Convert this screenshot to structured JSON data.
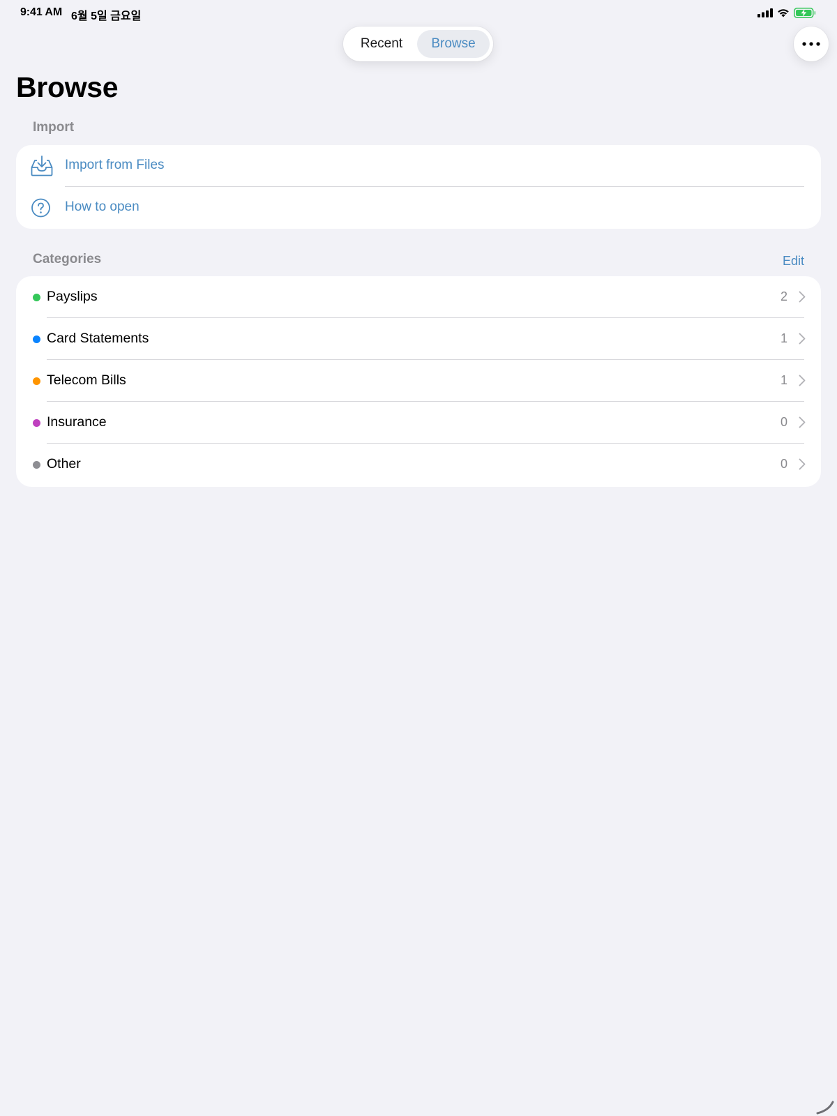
{
  "status_bar": {
    "time": "9:41 AM",
    "date": "6월 5일 금요일",
    "battery_color": "#34c759"
  },
  "segmented_control": {
    "options": [
      "Recent",
      "Browse"
    ],
    "selected": "Browse"
  },
  "more_button": {
    "icon": "ellipsis-icon"
  },
  "page": {
    "title": "Browse"
  },
  "import_section": {
    "header": "Import",
    "items": [
      {
        "label": "Import from Files",
        "icon": "tray-download-icon"
      },
      {
        "label": "How to open",
        "icon": "question-circle-icon"
      }
    ]
  },
  "categories_section": {
    "header": "Categories",
    "edit_label": "Edit",
    "items": [
      {
        "label": "Payslips",
        "count": "2",
        "color": "#34c759"
      },
      {
        "label": "Card Statements",
        "count": "1",
        "color": "#0a84ff"
      },
      {
        "label": "Telecom Bills",
        "count": "1",
        "color": "#ff9500"
      },
      {
        "label": "Insurance",
        "count": "0",
        "color": "#bf40bf"
      },
      {
        "label": "Other",
        "count": "0",
        "color": "#8e8e93"
      }
    ]
  },
  "theme": {
    "accent": "#4a8bc2",
    "background": "#f2f2f7"
  }
}
